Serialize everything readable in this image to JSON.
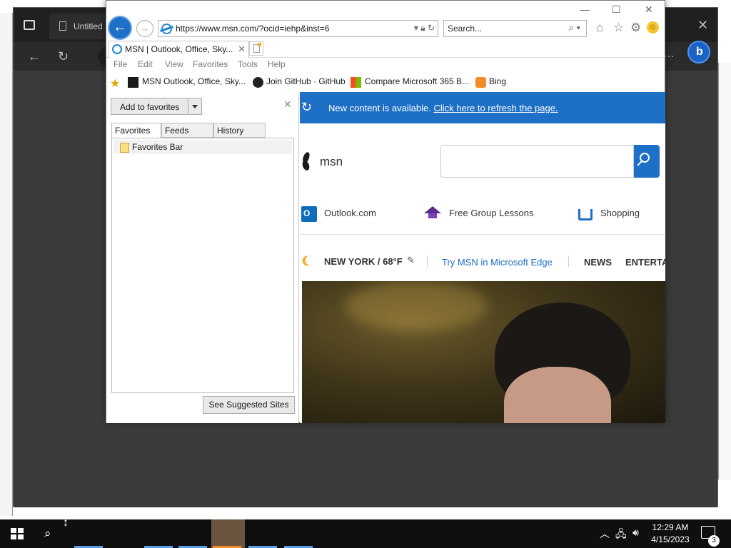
{
  "background_app": {
    "tab_title": "Untitled"
  },
  "ie": {
    "address_url": "https://www.msn.com/?ocid=iehp&inst=6",
    "search_placeholder": "Search...",
    "tab_title": "MSN | Outlook, Office, Sky...",
    "menu": [
      "File",
      "Edit",
      "View",
      "Favorites",
      "Tools",
      "Help"
    ],
    "favorites_bar": [
      {
        "label": "MSN  Outlook, Office, Sky...",
        "icon": "msn-icon"
      },
      {
        "label": "Join GitHub · GitHub",
        "icon": "github-icon"
      },
      {
        "label": "Compare Microsoft 365 B...",
        "icon": "microsoft-icon"
      },
      {
        "label": "Bing",
        "icon": "bing-icon"
      }
    ]
  },
  "fav_pane": {
    "add_button": "Add to favorites",
    "tabs": [
      "Favorites",
      "Feeds",
      "History"
    ],
    "items": [
      {
        "label": "Favorites Bar",
        "icon": "folder-icon"
      }
    ],
    "suggest_button": "See Suggested Sites"
  },
  "page": {
    "banner_text": "New content is available.",
    "banner_link": "Click here to refresh the page.",
    "logo_text": "msn",
    "quick_links": [
      {
        "label": "Outlook.com",
        "icon": "outlook-icon"
      },
      {
        "label": "Free Group Lessons",
        "icon": "graduation-cap-icon"
      },
      {
        "label": "Shopping",
        "icon": "shopping-cart-icon"
      }
    ],
    "weather": "NEW YORK / 68°F",
    "try_edge": "Try MSN in Microsoft Edge",
    "nav": [
      "NEWS",
      "ENTERTAI"
    ]
  },
  "taskbar": {
    "time": "12:29 AM",
    "date": "4/15/2023",
    "notification_count": "3"
  },
  "colors": {
    "accent_blue": "#1e6fc6",
    "taskbar": "#0f0f0f"
  }
}
